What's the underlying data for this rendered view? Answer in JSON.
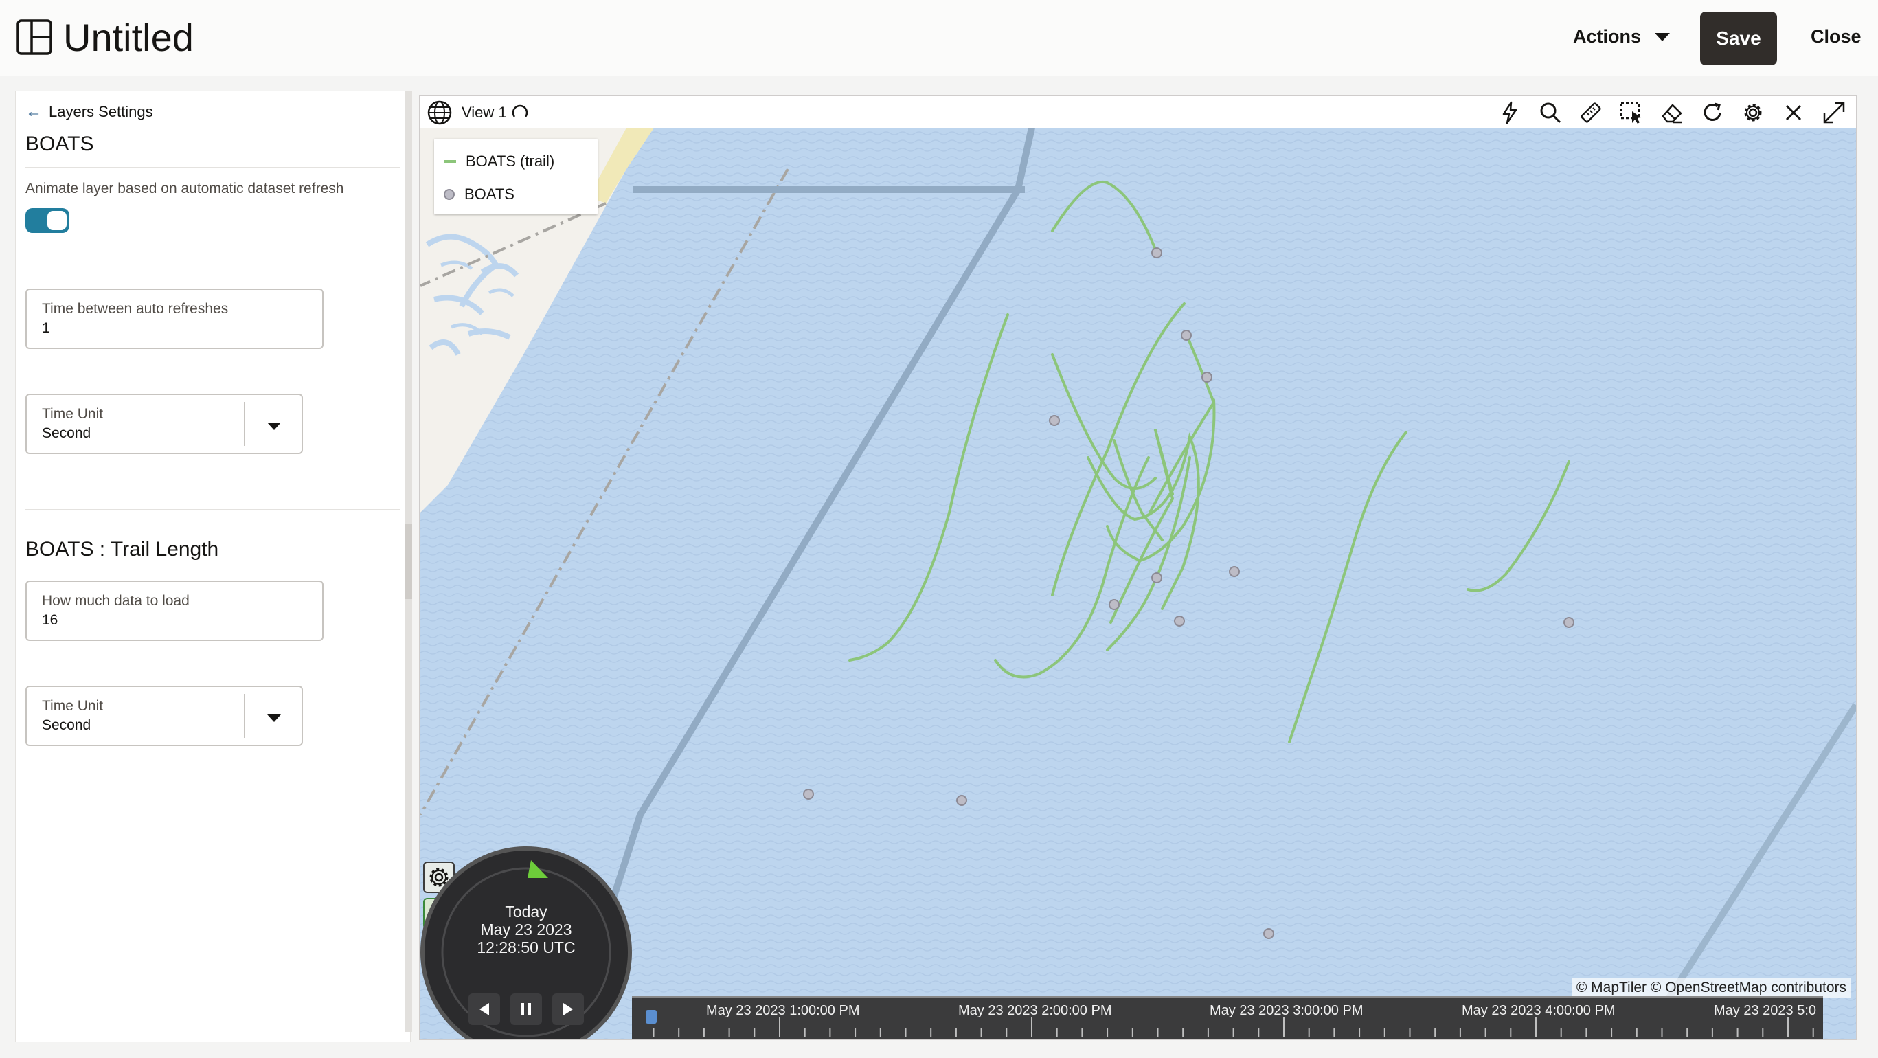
{
  "header": {
    "title": "Untitled",
    "actions_label": "Actions",
    "save_label": "Save",
    "close_label": "Close"
  },
  "panel": {
    "back_label": "Layers Settings",
    "layer_title": "BOATS",
    "animate_label": "Animate layer based on automatic dataset refresh",
    "animate_on": true,
    "refresh_field": {
      "label": "Time between auto refreshes",
      "value": "1"
    },
    "refresh_unit": {
      "label": "Time Unit",
      "value": "Second"
    },
    "trail_title": "BOATS : Trail Length",
    "trail_field": {
      "label": "How much data to load",
      "value": "16"
    },
    "trail_unit": {
      "label": "Time Unit",
      "value": "Second"
    }
  },
  "view": {
    "title": "View 1",
    "legend": {
      "trail_label": "BOATS (trail)",
      "points_label": "BOATS"
    },
    "attribution": "© MapTiler  © OpenStreetMap contributors",
    "timeline": {
      "labels": [
        "May 23 2023 1:00:00 PM",
        "May 23 2023 2:00:00 PM",
        "May 23 2023 3:00:00 PM",
        "May 23 2023 4:00:00 PM",
        "May 23 2023 5:0"
      ]
    },
    "clock": {
      "day": "Today",
      "date": "May 23 2023",
      "time": "12:28:50 UTC"
    },
    "colors": {
      "water": "#bdd5ee",
      "land": "#f3f1ec",
      "trail": "#8cc57a",
      "boat": "#bdbcc6",
      "road": "#92abc4"
    }
  }
}
